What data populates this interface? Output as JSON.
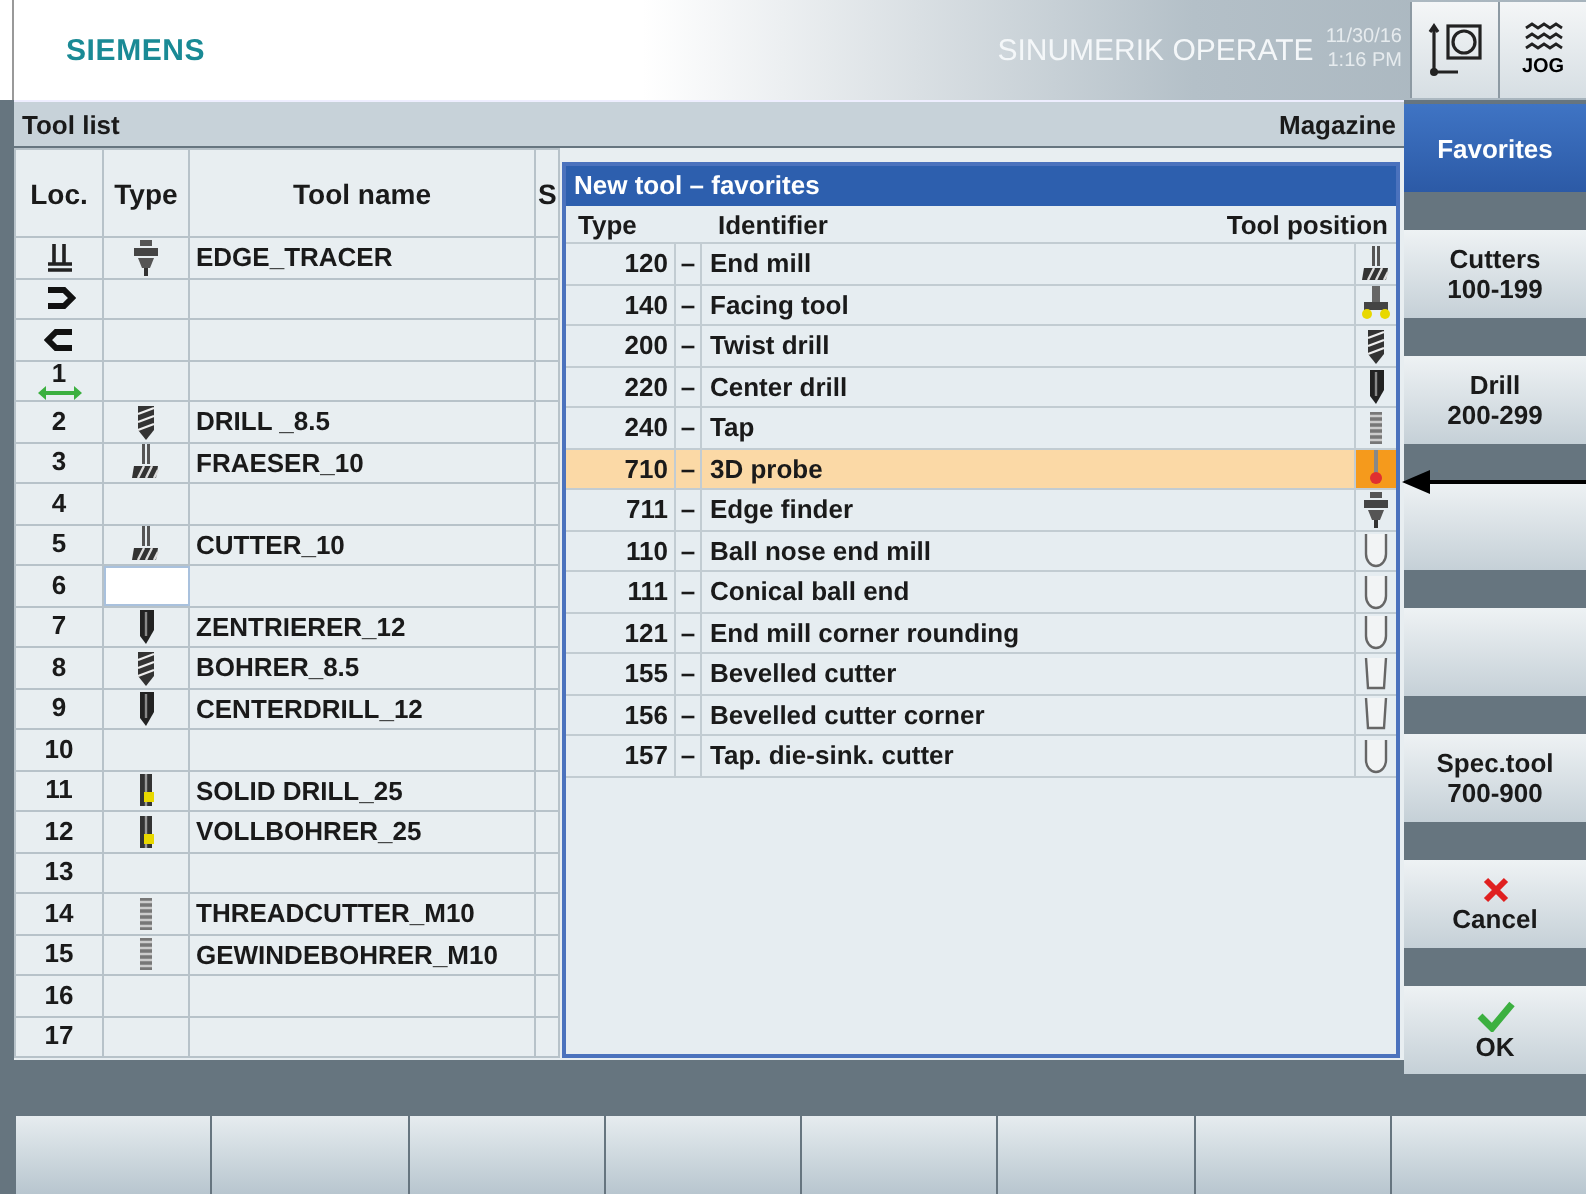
{
  "header": {
    "logo": "SIEMENS",
    "product": "SINUMERIK OPERATE",
    "date": "11/30/16",
    "time": "1:16 PM",
    "mode": "JOG"
  },
  "tool_list": {
    "title": "Tool list",
    "magazine": "Magazine",
    "columns": [
      "Loc.",
      "Type",
      "Tool name",
      "S"
    ],
    "rows": [
      {
        "loc": {
          "kind": "spindle"
        },
        "tool": {
          "kind": "edge_tracer",
          "name": "EDGE_TRACER"
        },
        "selected": false
      },
      {
        "loc": {
          "kind": "gripper_right"
        },
        "selected": false
      },
      {
        "loc": {
          "kind": "gripper_left"
        },
        "selected": false
      },
      {
        "loc": {
          "kind": "swap",
          "label": "1"
        },
        "selected": false
      },
      {
        "loc": {
          "kind": "number",
          "label": "2"
        },
        "tool": {
          "kind": "drill",
          "name": "DRILL _8.5"
        },
        "selected": false
      },
      {
        "loc": {
          "kind": "number",
          "label": "3"
        },
        "tool": {
          "kind": "mill",
          "name": "FRAESER_10"
        },
        "selected": false
      },
      {
        "loc": {
          "kind": "number",
          "label": "4"
        },
        "selected": false
      },
      {
        "loc": {
          "kind": "number",
          "label": "5"
        },
        "tool": {
          "kind": "mill",
          "name": "CUTTER_10"
        },
        "selected": false
      },
      {
        "loc": {
          "kind": "number",
          "label": "6"
        },
        "selected": true
      },
      {
        "loc": {
          "kind": "number",
          "label": "7"
        },
        "tool": {
          "kind": "center_drill",
          "name": "ZENTRIERER_12"
        },
        "selected": false
      },
      {
        "loc": {
          "kind": "number",
          "label": "8"
        },
        "tool": {
          "kind": "drill",
          "name": "BOHRER_8.5"
        },
        "selected": false
      },
      {
        "loc": {
          "kind": "number",
          "label": "9"
        },
        "tool": {
          "kind": "center_drill",
          "name": "CENTERDRILL_12"
        },
        "selected": false
      },
      {
        "loc": {
          "kind": "number",
          "label": "10"
        },
        "selected": false
      },
      {
        "loc": {
          "kind": "number",
          "label": "11"
        },
        "tool": {
          "kind": "solid_drill",
          "name": "SOLID DRILL_25"
        },
        "selected": false
      },
      {
        "loc": {
          "kind": "number",
          "label": "12"
        },
        "tool": {
          "kind": "solid_drill",
          "name": "VOLLBOHRER_25"
        },
        "selected": false
      },
      {
        "loc": {
          "kind": "number",
          "label": "13"
        },
        "selected": false
      },
      {
        "loc": {
          "kind": "number",
          "label": "14"
        },
        "tool": {
          "kind": "tap",
          "name": "THREADCUTTER_M10"
        },
        "selected": false
      },
      {
        "loc": {
          "kind": "number",
          "label": "15"
        },
        "tool": {
          "kind": "tap",
          "name": "GEWINDEBOHRER_M10"
        },
        "selected": false
      },
      {
        "loc": {
          "kind": "number",
          "label": "16"
        },
        "selected": false
      },
      {
        "loc": {
          "kind": "number",
          "label": "17"
        },
        "selected": false
      }
    ]
  },
  "dialog": {
    "title": "New tool – favorites",
    "columns": [
      "Type",
      "Identifier",
      "Tool position"
    ],
    "rows": [
      {
        "type": "120",
        "dash": "–",
        "identifier": "End mill",
        "kind": "mill",
        "selected": false
      },
      {
        "type": "140",
        "dash": "–",
        "identifier": "Facing tool",
        "kind": "facing",
        "selected": false
      },
      {
        "type": "200",
        "dash": "–",
        "identifier": "Twist drill",
        "kind": "drill",
        "selected": false
      },
      {
        "type": "220",
        "dash": "–",
        "identifier": "Center drill",
        "kind": "center_drill",
        "selected": false
      },
      {
        "type": "240",
        "dash": "–",
        "identifier": "Tap",
        "kind": "tap",
        "selected": false
      },
      {
        "type": "710",
        "dash": "–",
        "identifier": "3D probe",
        "kind": "probe",
        "selected": true
      },
      {
        "type": "711",
        "dash": "–",
        "identifier": "Edge finder",
        "kind": "edge_tracer",
        "selected": false
      },
      {
        "type": "110",
        "dash": "–",
        "identifier": "Ball nose end mill",
        "kind": "round_cutter",
        "selected": false
      },
      {
        "type": "111",
        "dash": "–",
        "identifier": "Conical ball end",
        "kind": "round_cutter",
        "selected": false
      },
      {
        "type": "121",
        "dash": "–",
        "identifier": "End mill corner rounding",
        "kind": "round_cutter",
        "selected": false
      },
      {
        "type": "155",
        "dash": "–",
        "identifier": "Bevelled cutter",
        "kind": "bevel_cutter",
        "selected": false
      },
      {
        "type": "156",
        "dash": "–",
        "identifier": "Bevelled cutter corner",
        "kind": "bevel_cutter",
        "selected": false
      },
      {
        "type": "157",
        "dash": "–",
        "identifier": "Tap. die-sink. cutter",
        "kind": "round_cutter",
        "selected": false
      }
    ]
  },
  "softkeys": [
    {
      "kind": "text",
      "label": "Favorites",
      "selected": true
    },
    {
      "kind": "text",
      "label": "Cutters",
      "sublabel": "100-199",
      "selected": false
    },
    {
      "kind": "text",
      "label": "Drill",
      "sublabel": "200-299",
      "selected": false
    },
    {
      "kind": "blank",
      "selected": false
    },
    {
      "kind": "blank",
      "selected": false
    },
    {
      "kind": "text",
      "label": "Spec.tool",
      "sublabel": "700-900",
      "selected": false
    },
    {
      "kind": "cancel",
      "label": "Cancel",
      "selected": false
    },
    {
      "kind": "ok",
      "label": "OK",
      "selected": false
    }
  ]
}
